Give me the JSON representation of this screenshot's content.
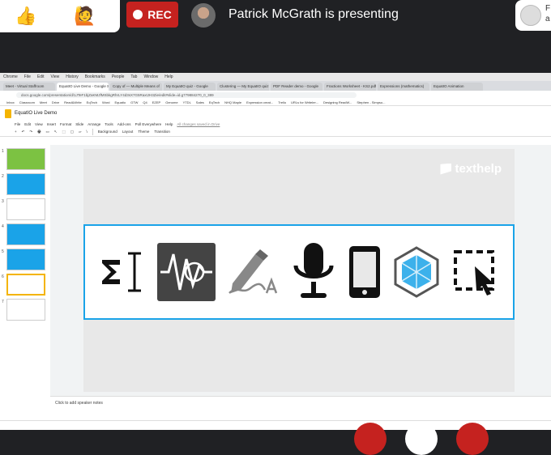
{
  "meeting": {
    "reactions": [
      "👍",
      "🙋"
    ],
    "rec_label": "REC",
    "presenter_text": "Patrick McGrath is presenting",
    "side_tile_text": "F\na"
  },
  "browser": {
    "menu": [
      "Chrome",
      "File",
      "Edit",
      "View",
      "History",
      "Bookmarks",
      "People",
      "Tab",
      "Window",
      "Help"
    ],
    "tabs": [
      "Meet - Virtual Staffroom",
      "EquatIO Live Demo - Google Sl",
      "Copy of — Multiple Means of",
      "My EquatIO quiz - Google",
      "Clustering — My EquatIO quiz",
      "PDF Reader demo - Google",
      "Fractions Worksheet - KS2.pdf",
      "Expressions (mathematics)",
      "EquatIO Animation"
    ],
    "active_tab": 1,
    "url": "docs.google.com/presentation/d/1JTeF1bjZaKMJfMSbkgRhrLY4d3sX7G5RaxtJH3Zie/edit#slide=id.g779884270_0_389",
    "bookmarks": [
      "Inbox",
      "Classroom",
      "Meet",
      "Drive",
      "Read&Write",
      "EqTech",
      "Word",
      "Equatio",
      "GTW",
      "Q4",
      "EZEP",
      "Genome",
      "YTDL",
      "Sales",
      "EqTech",
      "NHQ Maple",
      "Expression creat...",
      "Trello",
      "URLs for WriteIer...",
      "Designing ReadW...",
      "Stephen - Simpso..."
    ]
  },
  "slides": {
    "doc_title": "EquatIO Live Demo",
    "menu": [
      "File",
      "Edit",
      "View",
      "Insert",
      "Format",
      "Slide",
      "Arrange",
      "Tools",
      "Add-ons",
      "Poll Everywhere",
      "Help"
    ],
    "saved_text": "All changes saved in Drive",
    "toolbar": [
      "Background",
      "Layout",
      "Theme",
      "Transition"
    ],
    "thumbnails": [
      {
        "num": "1",
        "color": "#7cc242"
      },
      {
        "num": "2",
        "color": "#1aa3e8"
      },
      {
        "num": "3",
        "color": "#ffffff"
      },
      {
        "num": "4",
        "color": "#1aa3e8"
      },
      {
        "num": "5",
        "color": "#1aa3e8"
      },
      {
        "num": "6",
        "color": "#ffffff"
      },
      {
        "num": "7",
        "color": "#ffffff"
      }
    ],
    "selected_thumb": 5,
    "brand": "texthelp",
    "banner_icons": [
      "sigma-cursor-icon",
      "waveform-icon",
      "handwriting-pen-icon",
      "microphone-icon",
      "mobile-phone-icon",
      "cube-icon",
      "screenshot-select-icon"
    ],
    "notes_placeholder": "Click to add speaker notes"
  },
  "colors": {
    "rec": "#c5221f",
    "banner_border": "#1aa3e8",
    "slide_bg": "#e8e8e8",
    "meet_bg": "#202124"
  }
}
